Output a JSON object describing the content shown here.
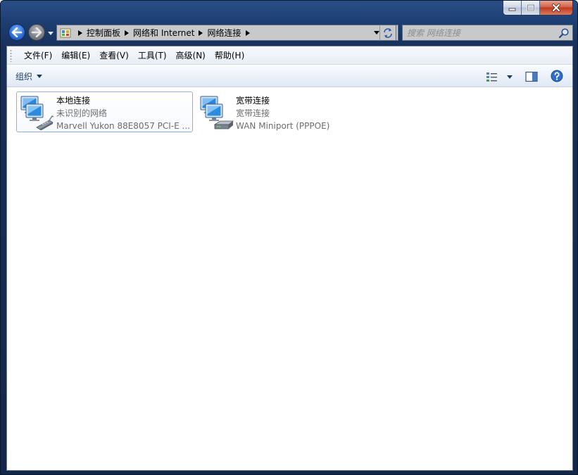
{
  "window": {
    "caption_buttons": [
      "minimize",
      "maximize",
      "close"
    ]
  },
  "address": {
    "crumbs": [
      "控制面板",
      "网络和 Internet",
      "网络连接"
    ]
  },
  "search": {
    "placeholder": "搜索 网络连接"
  },
  "menu": {
    "items": [
      "文件(F)",
      "编辑(E)",
      "查看(V)",
      "工具(T)",
      "高级(N)",
      "帮助(H)"
    ]
  },
  "command": {
    "organize_label": "组织"
  },
  "connections": [
    {
      "name": "本地连接",
      "status": "未识别的网络",
      "device": "Marvell Yukon 88E8057 PCI-E ...",
      "icon": "lan-adapter-icon",
      "selected": true
    },
    {
      "name": "宽带连接",
      "status": "宽带连接",
      "device": "WAN Miniport (PPPOE)",
      "icon": "broadband-modem-icon",
      "selected": false
    }
  ],
  "colors": {
    "frame": "#1c3e73",
    "close_button": "#c1391f",
    "selection_border": "#8fb2dc"
  }
}
